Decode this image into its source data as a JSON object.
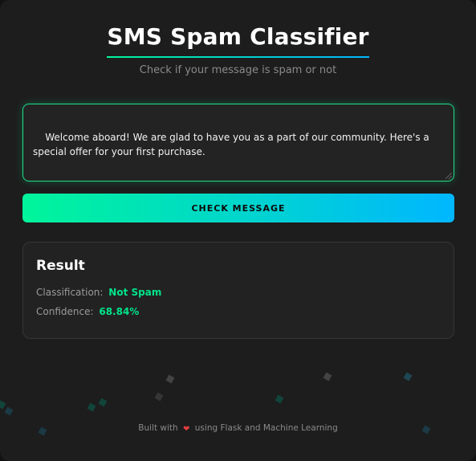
{
  "header": {
    "title": "SMS Spam Classifier",
    "subtitle": "Check if your message is spam or not"
  },
  "message": {
    "value": "Welcome aboard! We are glad to have you as a part of our community. Here's a special offer for your first purchase."
  },
  "actions": {
    "check_label": "CHECK MESSAGE"
  },
  "result": {
    "title": "Result",
    "classification_label": "Classification:",
    "classification_value": "Not Spam",
    "confidence_label": "Confidence:",
    "confidence_value": "68.84%"
  },
  "footer": {
    "prefix": "Built with",
    "suffix": "using Flask and Machine Learning",
    "icon": "heart-icon"
  },
  "theme": {
    "accent_start": "#00f59a",
    "accent_end": "#00b7ff",
    "success": "#00e38a"
  }
}
